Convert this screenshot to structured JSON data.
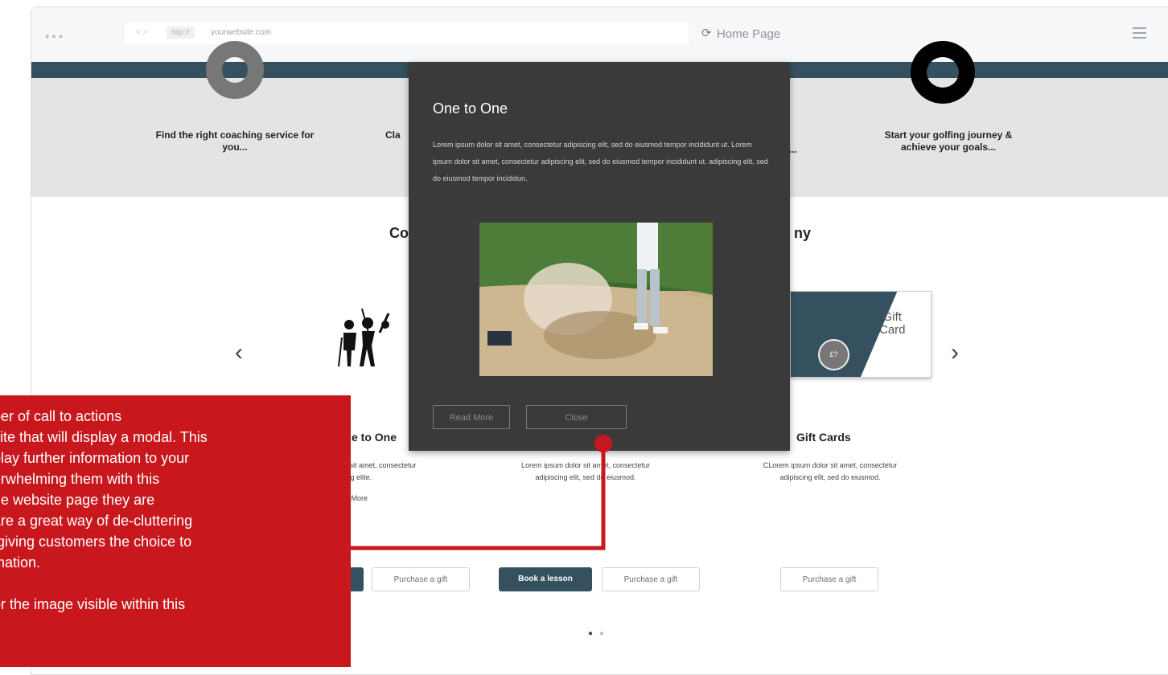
{
  "browser": {
    "window_dots": "●●●",
    "nav_arrows": "< >",
    "scheme": "http://",
    "url": "yourwebsite.com",
    "page_title": "Home Page",
    "reload_icon": "reload-icon",
    "menu_icon": "hamburger-icon"
  },
  "features": [
    {
      "text": "Find the right coaching service for you..."
    },
    {
      "text": "Cla"
    },
    {
      "text": "r..."
    },
    {
      "text": "Start your golfing journey & achieve your goals..."
    }
  ],
  "section": {
    "title_left": "Co",
    "title_right": "ny"
  },
  "carousel": {
    "prev": "‹",
    "next": "›",
    "gift_line1": "Gift",
    "gift_line2": "Card",
    "coin_text": "£?"
  },
  "cards": [
    {
      "title": "e to One",
      "text": "or sit amet, consectetur",
      "text2": "cing elite.",
      "link": "ad More"
    },
    {
      "text": "Lorem ipsum dolor sit amet, consectetur",
      "text2": "adipiscing elit, sed do eiusmod."
    },
    {
      "title": "Gift Cards",
      "text": "CLorem ipsum dolor sit amet, consectetur",
      "text2": "adipiscing elit, sed do eiusmod."
    }
  ],
  "buttons": {
    "purchase_gift_1": "Purchase a gift",
    "book_lesson": "Book a lesson",
    "purchase_gift_2": "Purchase a gift",
    "purchase_gift_3": "Purchase a gift"
  },
  "pager": {
    "active": "●",
    "inactive": "●"
  },
  "modal": {
    "title": "One to One",
    "body": "Lorem ipsum dolor sit amet, consectetur adipiscing elit, sed do eiusmod tempor incididunt ut. Lorem ipsum dolor sit amet, consectetur adipiscing elit, sed do eiusmod tempor incididunt ut. adipiscing elit, sed do eiusmod tempor incididun.",
    "read_more": "Read More",
    "close": "Close"
  },
  "callout": {
    "text": "ber of call to actions\nsite that will display a modal. This\nplay further information to your\nerwhelming them with this\nhe website page they are\nare a great way of de-cluttering\n giving customers the choice to\nmation.\n\nor the image visible within this"
  },
  "colors": {
    "brand": "#35515f",
    "modal_bg": "#3a3a3a",
    "callout_red": "#c8181e"
  }
}
